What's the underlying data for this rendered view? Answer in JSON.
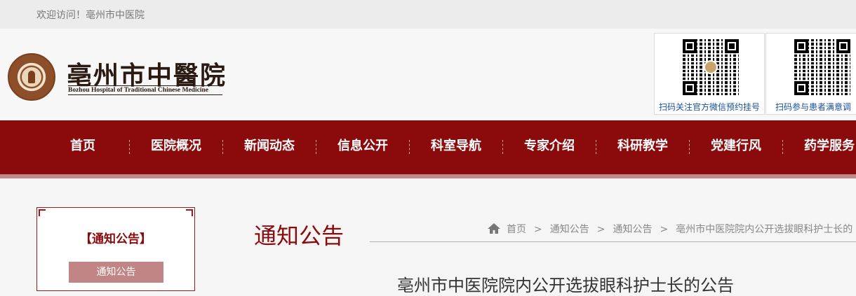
{
  "topbar": {
    "welcome": "欢迎访问！亳州市中医院"
  },
  "logo": {
    "title": "亳州市中醫院",
    "subtitle": "Bozhou Hospital of Traditional Chinese Medicine"
  },
  "qr_codes": [
    {
      "caption": "扫码关注官方微信预约挂号"
    },
    {
      "caption": "扫码参与患者满意调"
    }
  ],
  "nav": {
    "items": [
      {
        "label": "首页"
      },
      {
        "label": "医院概况"
      },
      {
        "label": "新闻动态"
      },
      {
        "label": "信息公开"
      },
      {
        "label": "科室导航"
      },
      {
        "label": "专家介绍"
      },
      {
        "label": "科研教学"
      },
      {
        "label": "党建行风"
      },
      {
        "label": "药学服务"
      }
    ]
  },
  "sidebar": {
    "title": "【通知公告】",
    "active_item": "通知公告"
  },
  "main": {
    "page_title": "通知公告",
    "breadcrumb": [
      "首页",
      "通知公告",
      "通知公告",
      "亳州市中医院院内公开选拔眼科护士长的"
    ],
    "breadcrumb_sep": ">",
    "article_title": "亳州市中医院院内公开选拔眼科护士长的公告"
  },
  "colors": {
    "brand_red": "#8b0a0c",
    "link_blue": "#1a4fa0",
    "sidebar_active": "#c18585"
  }
}
